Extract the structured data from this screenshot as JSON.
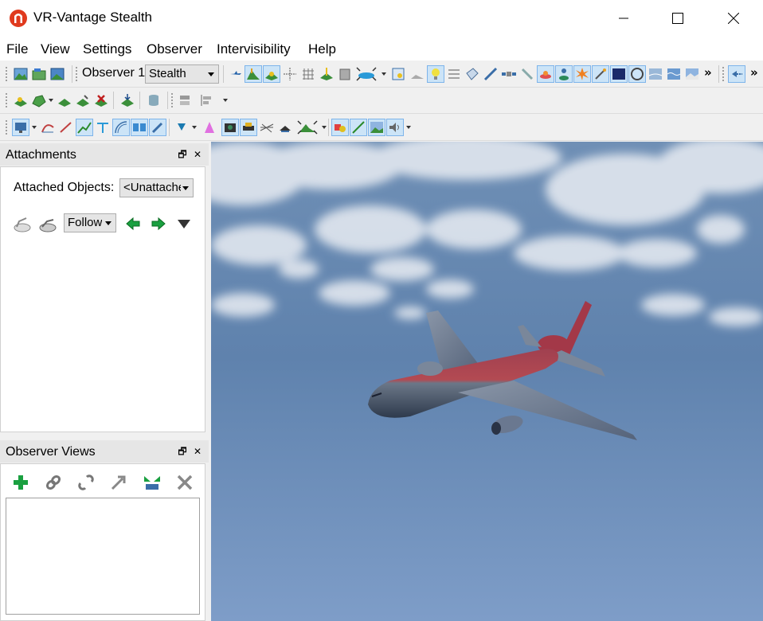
{
  "window": {
    "title": "VR-Vantage Stealth",
    "app_icon": "vr-vantage-logo-icon",
    "controls": [
      "minimize-icon",
      "maximize-icon",
      "close-icon"
    ]
  },
  "menu": {
    "items": [
      "File",
      "View",
      "Settings",
      "Observer",
      "Intervisibility",
      "Help"
    ]
  },
  "toolbar": {
    "observer_label": "Observer 1",
    "observer_mode": "Stealth",
    "overflow": "»"
  },
  "attachments": {
    "title": "Attachments",
    "attached_objects_label": "Attached Objects:",
    "attached_objects_value": "<Unattached>",
    "follow_mode": "Follow"
  },
  "observer_views": {
    "title": "Observer Views",
    "buttons": [
      "add-view-icon",
      "attach-link-icon",
      "detach-link-icon",
      "jump-to-icon",
      "merge-views-icon",
      "delete-view-icon"
    ],
    "items": []
  },
  "dock": {
    "float_glyph": "🗗",
    "close_glyph": "✕"
  },
  "colors": {
    "accent_active": "#cce4f7",
    "sky_top": "#5b7fa8",
    "sky_bottom": "#7d9dc8",
    "aircraft_stripe": "#b4444a"
  }
}
